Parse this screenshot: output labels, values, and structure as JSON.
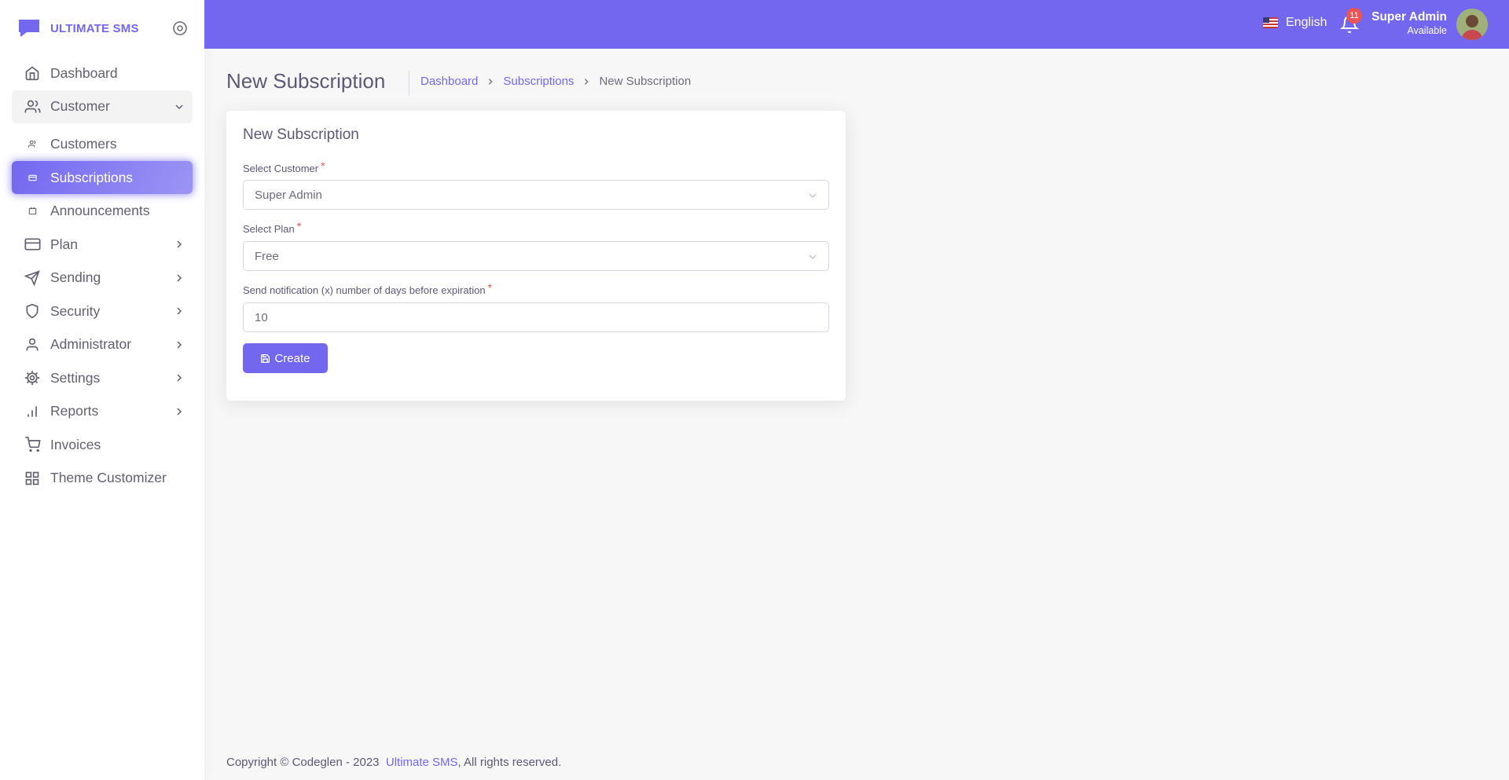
{
  "brand": {
    "name": "ULTIMATE SMS",
    "color": "#7367f0"
  },
  "sidebar": {
    "items": [
      {
        "label": "Dashboard",
        "icon": "home-icon"
      },
      {
        "label": "Customer",
        "icon": "users-icon",
        "expanded": true
      },
      {
        "label": "Customers",
        "icon": "users-small-icon"
      },
      {
        "label": "Subscriptions",
        "icon": "card-icon",
        "active": true
      },
      {
        "label": "Announcements",
        "icon": "calendar-icon"
      },
      {
        "label": "Plan",
        "icon": "credit-card-icon"
      },
      {
        "label": "Sending",
        "icon": "send-icon"
      },
      {
        "label": "Security",
        "icon": "shield-icon"
      },
      {
        "label": "Administrator",
        "icon": "user-icon"
      },
      {
        "label": "Settings",
        "icon": "gear-icon"
      },
      {
        "label": "Reports",
        "icon": "bar-chart-icon"
      },
      {
        "label": "Invoices",
        "icon": "shopping-cart-icon"
      },
      {
        "label": "Theme Customizer",
        "icon": "grid-icon"
      }
    ]
  },
  "topbar": {
    "language": "English",
    "notifications_count": "11",
    "user_name": "Super Admin",
    "user_status": "Available"
  },
  "page": {
    "title": "New Subscription",
    "breadcrumb": {
      "home": "Dashboard",
      "parent": "Subscriptions",
      "current": "New Subscription"
    }
  },
  "form": {
    "title": "New Subscription",
    "customer_label": "Select Customer",
    "customer_value": "Super Admin",
    "plan_label": "Select Plan",
    "plan_value": "Free",
    "days_label": "Send notification (x) number of days before expiration",
    "days_value": "10",
    "required_mark": "*",
    "submit_label": "Create"
  },
  "footer": {
    "text": "Copyright © Codeglen - 2023",
    "link": "Ultimate SMS",
    "suffix": ", All rights reserved."
  }
}
